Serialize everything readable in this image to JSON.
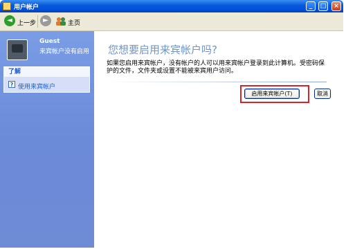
{
  "window": {
    "title": "用户帐户",
    "minimize": "_",
    "maximize": "□",
    "close": "×"
  },
  "toolbar": {
    "back_label": "上一步",
    "home_label": "主页"
  },
  "icons": {
    "back": "back-arrow-icon",
    "forward": "forward-arrow-icon",
    "home": "users-home-icon",
    "help": "help-icon",
    "avatar": "briefcase-avatar-icon"
  },
  "sidebar": {
    "user_name": "Guest",
    "user_status": "来宾帐户没有启用",
    "learn_header": "了解",
    "help_link": "使用来宾帐户"
  },
  "main": {
    "heading": "您想要启用来宾帐户吗?",
    "description": "如果您启用来宾帐户，没有帐户的人可以用来宾帐户登录到此计算机。受密码保护的文件，文件夹或设置不能被来宾用户访问。",
    "enable_button": "启用来宾帐户(T)",
    "cancel_button": "取消"
  },
  "colors": {
    "highlight": "#d9232a",
    "heading": "#6e95c9",
    "sidebar": "#7a9de6"
  }
}
